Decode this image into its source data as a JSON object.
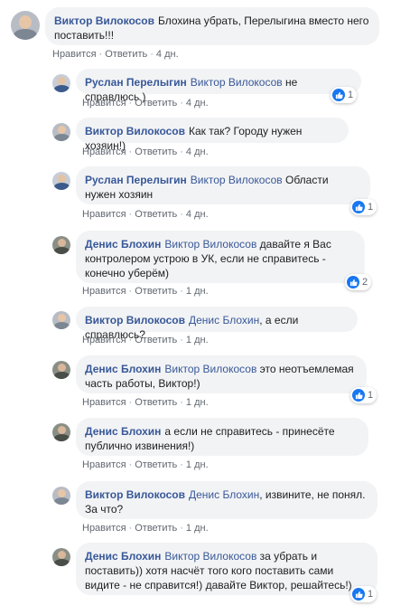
{
  "labels": {
    "like": "Нравится",
    "reply": "Ответить",
    "sep": "·"
  },
  "colors": {
    "author": "#385898",
    "bubble": "#f2f3f5",
    "like_badge": "#1877f2",
    "meta": "#606770"
  },
  "comments": [
    {
      "author": "Виктор Вилокосов",
      "text": "Блохина убрать, Перелыгина вместо него поставить!!!",
      "time": "4 дн.",
      "reactions": null
    },
    {
      "author": "Руслан Перелыгин",
      "mention": "Виктор Вилокосов",
      "text": "не справлюсь )",
      "time": "4 дн.",
      "reactions": "1"
    },
    {
      "author": "Виктор Вилокосов",
      "text": "Как так? Городу нужен хозяин!)",
      "time": "4 дн.",
      "reactions": null
    },
    {
      "author": "Руслан Перелыгин",
      "mention": "Виктор Вилокосов",
      "text": "Области нужен хозяин",
      "time": "4 дн.",
      "reactions": "1"
    },
    {
      "author": "Денис Блохин",
      "mention": "Виктор Вилокосов",
      "text": "давайте я Вас контролером устрою в УК, если не справитесь - конечно уберём)",
      "time": "1 дн.",
      "reactions": "2"
    },
    {
      "author": "Виктор Вилокосов",
      "mention": "Денис Блохин",
      "text": ", а если справлюсь?",
      "time": "1 дн.",
      "reactions": null
    },
    {
      "author": "Денис Блохин",
      "mention": "Виктор Вилокосов",
      "text": "это неотъемлемая часть работы, Виктор!)",
      "time": "1 дн.",
      "reactions": "1"
    },
    {
      "author": "Денис Блохин",
      "text": "а если не справитесь - принесёте публично извинения!)",
      "time": "1 дн.",
      "reactions": null
    },
    {
      "author": "Виктор Вилокосов",
      "mention": "Денис Блохин",
      "text": ", извините, не понял. За что?",
      "time": "1 дн.",
      "reactions": null
    },
    {
      "author": "Денис Блохин",
      "mention": "Виктор Вилокосов",
      "text": "за убрать и поставить)) хотя насчёт того кого поставить сами видите - не справится!) давайте Виктор, решайтесь!)",
      "time": "1 дн.",
      "reactions": "1"
    }
  ]
}
